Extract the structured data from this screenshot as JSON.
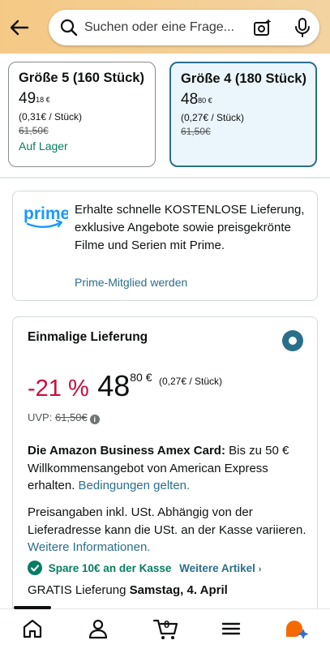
{
  "header": {
    "search_placeholder": "Suchen oder eine Frage..."
  },
  "sizes": [
    {
      "name": "Größe 5 (160 Stück)",
      "price_main": "49",
      "price_frac": "18 €",
      "unit": "(0,31€ / Stück)",
      "list_price": "61,50€",
      "stock": "Auf Lager"
    },
    {
      "name": "Größe 4 (180 Stück)",
      "price_main": "48",
      "price_frac": "80 €",
      "unit": "(0,27€ / Stück)",
      "list_price": "61,50€"
    }
  ],
  "prime": {
    "logo_text": "prime",
    "text": "Erhalte schnelle KOSTENLOSE Lieferung, exklusive Angebote sowie preisgekrönte Filme und Serien mit Prime.",
    "link": "Prime-Mitglied werden"
  },
  "offer": {
    "title": "Einmalige Lieferung",
    "discount": "-21 %",
    "price_main": "48",
    "price_frac": "80 €",
    "unit": "(0,27€ / Stück)",
    "uvp_label": "UVP:",
    "uvp_value": "61,50€",
    "amex_bold": "Die Amazon Business Amex Card:",
    "amex_text": " Bis zu 50 € Willkommensangebot von American Express erhalten. ",
    "amex_link": "Bedingungen gelten.",
    "tax_text": "Preisangaben inkl. USt. Abhängig von der Lieferadresse kann die USt. an der Kasse variieren. ",
    "tax_link": "Weitere Informationen.",
    "save_text": "Spare 10€ an der Kasse",
    "save_link": "Weitere Artikel",
    "delivery_prefix": "GRATIS Lieferung ",
    "delivery_date": "Samstag, 4. April"
  },
  "bottom_nav": {
    "cart_count": "0"
  },
  "colors": {
    "accent": "#2a6f8a",
    "discount": "#cc0c39",
    "stock": "#067d62"
  }
}
